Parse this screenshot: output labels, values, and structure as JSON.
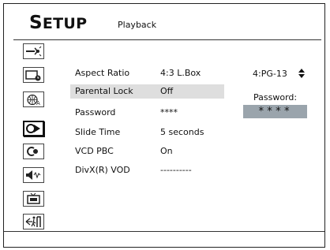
{
  "header": {
    "title": "SETUP",
    "subtitle": "Playback"
  },
  "sidebar": {
    "items": [
      {
        "name": "general-setup",
        "icon": "satellite-dish-icon"
      },
      {
        "name": "time-setup",
        "icon": "tv-clock-icon"
      },
      {
        "name": "language-setup",
        "icon": "globe-text-icon"
      },
      {
        "name": "playback-setup",
        "icon": "play-arrow-icon",
        "active": true
      },
      {
        "name": "display-setup",
        "icon": "disc-arrow-icon"
      },
      {
        "name": "audio-setup",
        "icon": "speaker-icon"
      },
      {
        "name": "tv-setup",
        "icon": "television-icon"
      },
      {
        "name": "exit-setup",
        "icon": "exit-door-icon"
      }
    ]
  },
  "settings": [
    {
      "label": "Aspect Ratio",
      "value": "4:3 L.Box"
    },
    {
      "label": "Parental Lock",
      "value": "Off"
    },
    {
      "label": "Password",
      "value": "****"
    },
    {
      "label": "Slide Time",
      "value": "5 seconds"
    },
    {
      "label": "VCD PBC",
      "value": "On"
    },
    {
      "label": "DivX(R) VOD",
      "value": "----------"
    }
  ],
  "submenu": {
    "rating": "4:PG-13",
    "password_label": "Password:",
    "password_mask": "****"
  },
  "colors": {
    "highlight": "#dedede",
    "password_box": "#9aa4ac"
  }
}
